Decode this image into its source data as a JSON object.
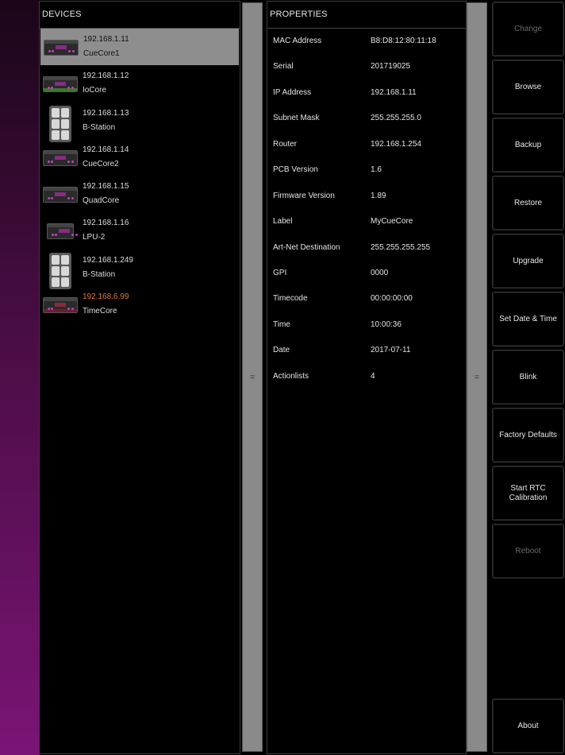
{
  "devices_panel": {
    "title": "DEVICES",
    "items": [
      {
        "ip": "192.168.1.11",
        "name": "CueCore1",
        "icon": "cuecore-icon",
        "selected": true
      },
      {
        "ip": "192.168.1.12",
        "name": "IoCore",
        "icon": "iocore-icon"
      },
      {
        "ip": "192.168.1.13",
        "name": "B-Station",
        "icon": "bstation-icon"
      },
      {
        "ip": "192.168.1.14",
        "name": "CueCore2",
        "icon": "cuecore-icon"
      },
      {
        "ip": "192.168.1.15",
        "name": "QuadCore",
        "icon": "quadcore-icon"
      },
      {
        "ip": "192.168.1.16",
        "name": "LPU-2",
        "icon": "lpu-icon"
      },
      {
        "ip": "192.168.1.249",
        "name": "B-Station",
        "icon": "bstation-icon"
      },
      {
        "ip": "192.168.6.99",
        "name": "TimeCore",
        "icon": "timecore-icon",
        "ip_color": "#e07a2a"
      }
    ]
  },
  "splitter_glyph": "=",
  "properties_panel": {
    "title": "PROPERTIES",
    "rows": [
      {
        "key": "MAC Address",
        "value": "B8:D8:12:80:11:18"
      },
      {
        "key": "Serial",
        "value": "201719025"
      },
      {
        "key": "IP Address",
        "value": "192.168.1.11"
      },
      {
        "key": "Subnet Mask",
        "value": "255.255.255.0"
      },
      {
        "key": "Router",
        "value": "192.168.1.254"
      },
      {
        "key": "PCB Version",
        "value": "1.6"
      },
      {
        "key": "Firmware Version",
        "value": "1.89"
      },
      {
        "key": "Label",
        "value": "MyCueCore"
      },
      {
        "key": "Art-Net Destination",
        "value": "255.255.255.255"
      },
      {
        "key": "GPI",
        "value": "0000"
      },
      {
        "key": "Timecode",
        "value": "00:00:00:00"
      },
      {
        "key": "Time",
        "value": "10:00:36"
      },
      {
        "key": "Date",
        "value": "2017-07-11"
      },
      {
        "key": "Actionlists",
        "value": "4"
      }
    ]
  },
  "actions": {
    "change": "Change",
    "browse": "Browse",
    "backup": "Backup",
    "restore": "Restore",
    "upgrade": "Upgrade",
    "set_date_time": "Set Date & Time",
    "blink": "Blink",
    "factory_defaults": "Factory Defaults",
    "start_rtc_line1": "Start RTC",
    "start_rtc_line2": "Calibration",
    "reboot": "Reboot",
    "about": "About"
  },
  "colors": {
    "background_gradient": "#7a1475",
    "selected_row": "#8e8e8e",
    "warning_ip": "#e07a2a",
    "disabled_text": "#6a6a6a"
  }
}
